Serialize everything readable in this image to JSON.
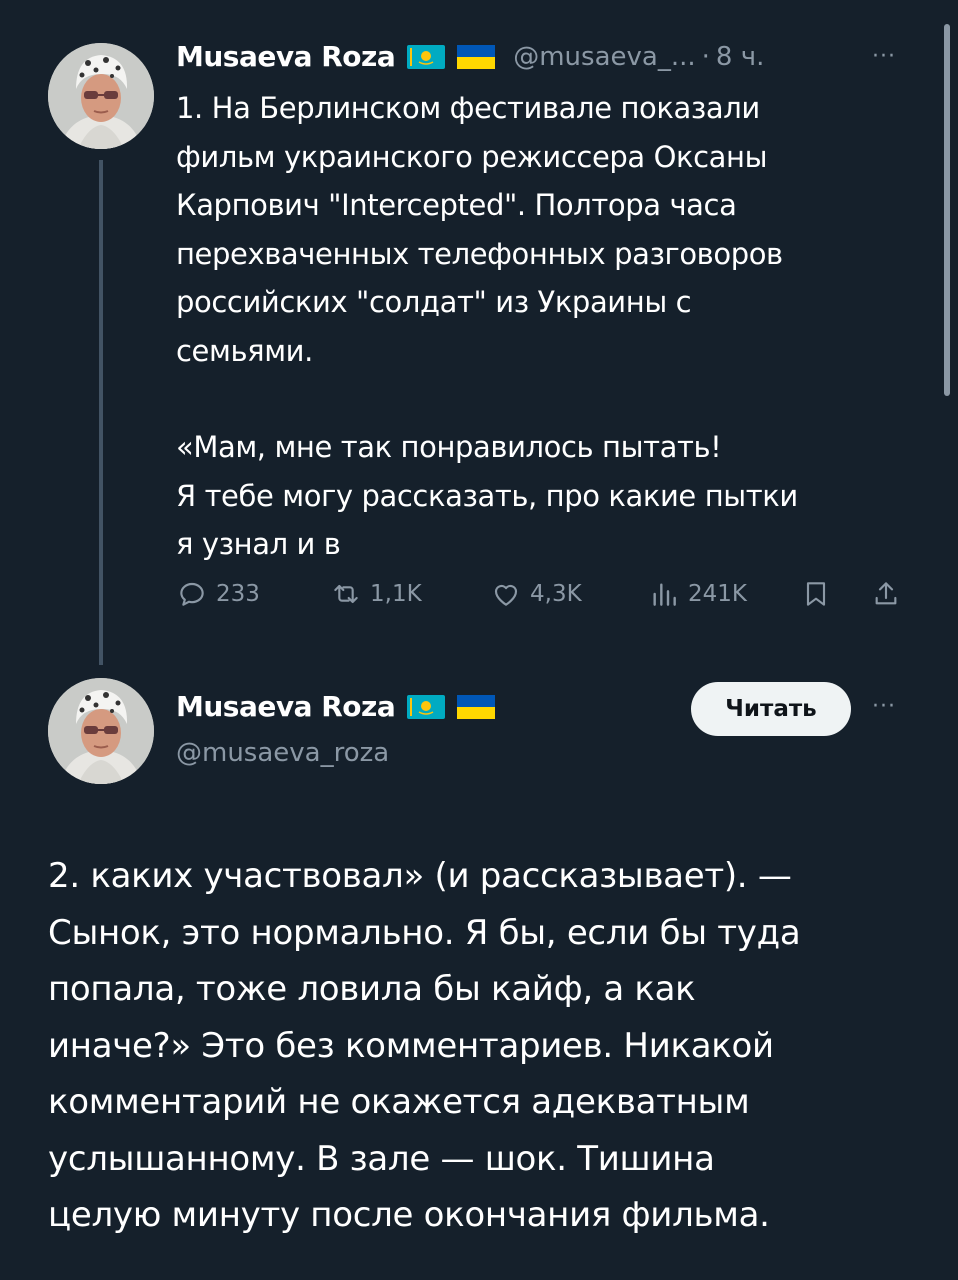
{
  "tweet1": {
    "author": "Musaeva Roza",
    "flags": [
      "kazakhstan-flag",
      "ukraine-flag"
    ],
    "handle": "@musaeva_...",
    "separator": "·",
    "time": "8 ч.",
    "more": "···",
    "paragraphs": [
      "1. На Берлинском фестивале показали\nфильм украинского режиссера Оксаны\nКарпович \"Intercepted\".  Полтора часа\nперехваченных телефонных разговоров\nроссийских \"солдат\" из Украины с\nсемьями.",
      "«Мам, мне так понравилось пытать!\nЯ тебе могу рассказать, про какие пытки\nя узнал и в"
    ],
    "actions": {
      "replies": "233",
      "reposts": "1,1K",
      "likes": "4,3K",
      "views": "241K"
    }
  },
  "tweet2": {
    "author": "Musaeva Roza",
    "flags": [
      "kazakhstan-flag",
      "ukraine-flag"
    ],
    "handle": "@musaeva_roza",
    "follow_label": "Читать",
    "more": "···",
    "text": "2. каких участвовал» (и рассказывает). —\nСынок, это нормально. Я бы, если бы туда\nпопала, тоже ловила бы кайф, а как\nиначе?»  Это без комментариев. Никакой\nкомментарий не окажется адекватным\nуслышанному. В зале — шок. Тишина\nцелую минуту после окончания фильма."
  },
  "colors": {
    "background": "#15202b",
    "text": "#ffffff",
    "secondary": "#8b98a5",
    "thread_line": "#425364",
    "button_bg": "#eff3f4"
  }
}
